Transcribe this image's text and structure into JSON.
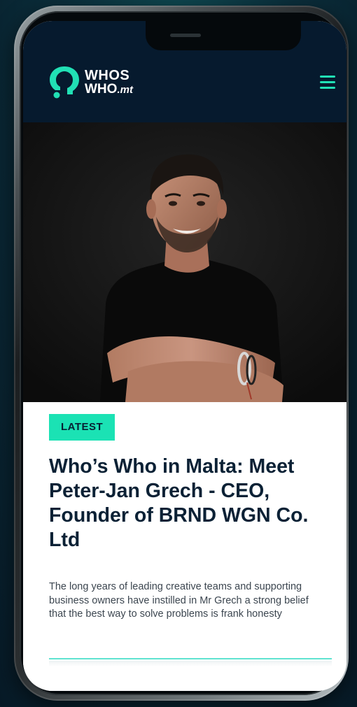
{
  "header": {
    "logo_line1": "WHOS",
    "logo_line2": "WHO",
    "logo_suffix": ".mt",
    "menu_icon": "hamburger-menu-icon",
    "accent_color": "#21e0b5",
    "background_color": "#061a2e"
  },
  "hero": {
    "image_subject": "portrait-photo"
  },
  "article": {
    "badge": "LATEST",
    "title": "Who’s Who in Malta: Meet Peter-Jan Grech - CEO, Founder of BRND WGN Co. Ltd",
    "excerpt": "The long years of leading creative teams and supporting business owners have instilled in Mr Grech a strong belief that the best way to solve problems is frank honesty",
    "badge_color": "#1be2b4",
    "title_color": "#0b2135"
  }
}
